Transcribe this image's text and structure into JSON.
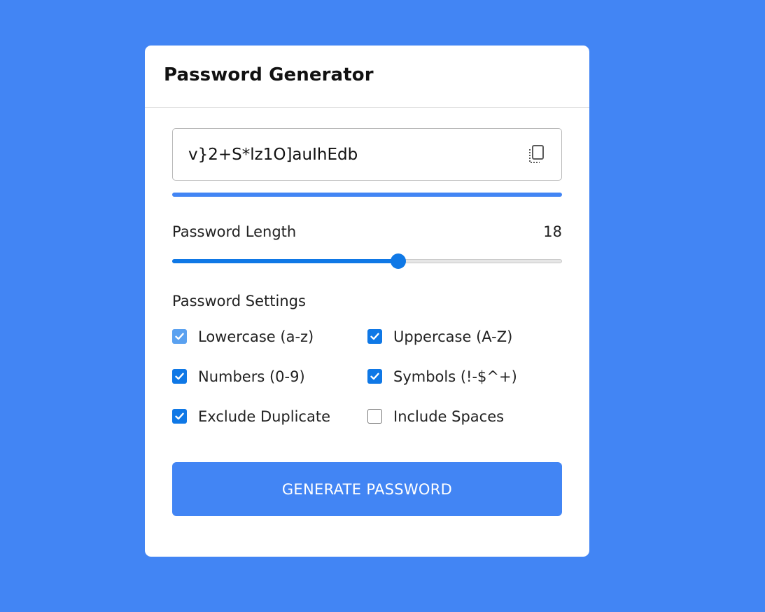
{
  "page": {
    "background_color": "#4285f4"
  },
  "card": {
    "title": "Password Generator"
  },
  "password": {
    "value": "v}2+S*lz1O]auIhEdb",
    "copy_icon": "copy-icon"
  },
  "strength": {
    "fraction": 1.0,
    "color": "#4285f4"
  },
  "length": {
    "label": "Password Length",
    "value": "18",
    "slider_fraction": 0.58,
    "accent_color": "#0f78e6"
  },
  "settings": {
    "title": "Password Settings",
    "options": [
      {
        "label": "Lowercase (a-z)",
        "checked": true,
        "disabled": true
      },
      {
        "label": "Uppercase (A-Z)",
        "checked": true,
        "disabled": false
      },
      {
        "label": "Numbers (0-9)",
        "checked": true,
        "disabled": false
      },
      {
        "label": "Symbols (!-$^+)",
        "checked": true,
        "disabled": false
      },
      {
        "label": "Exclude Duplicate",
        "checked": true,
        "disabled": false
      },
      {
        "label": "Include Spaces",
        "checked": false,
        "disabled": false
      }
    ]
  },
  "button": {
    "label": "GENERATE PASSWORD",
    "color": "#4285f4"
  }
}
